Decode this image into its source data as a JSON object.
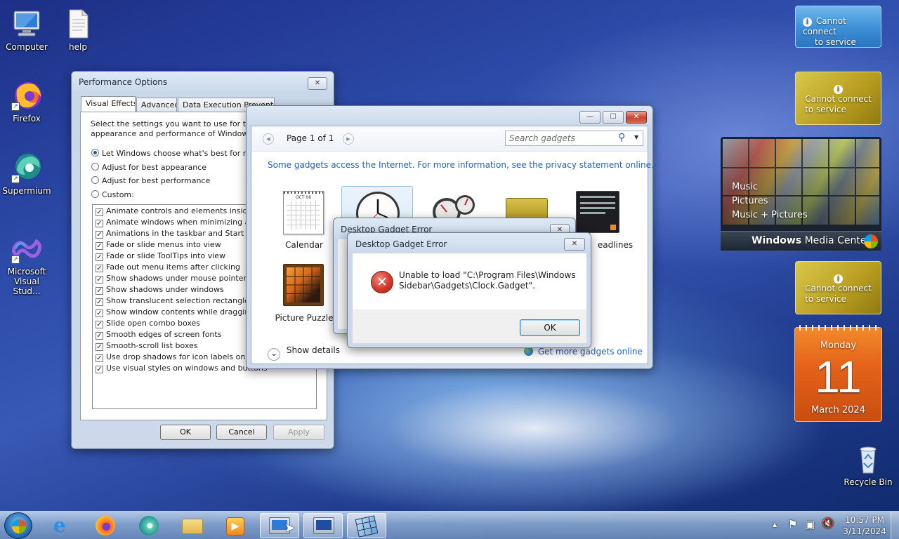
{
  "desktop": {
    "icons": [
      {
        "label": "Computer"
      },
      {
        "label": "help"
      },
      {
        "label": "Firefox"
      },
      {
        "label": "Supermium"
      },
      {
        "label": "Microsoft Visual Stud..."
      },
      {
        "label": "Recycle Bin"
      }
    ]
  },
  "perf": {
    "title": "Performance Options",
    "close_glyph": "✕",
    "tabs": [
      "Visual Effects",
      "Advanced",
      "Data Execution Prevention"
    ],
    "intro": "Select the settings you want to use for the appearance and performance of Windows on this computer.",
    "radios": [
      {
        "label": "Let Windows choose what's best for my computer",
        "selected": true
      },
      {
        "label": "Adjust for best appearance",
        "selected": false
      },
      {
        "label": "Adjust for best performance",
        "selected": false
      },
      {
        "label": "Custom:",
        "selected": false
      }
    ],
    "checks": [
      "Animate controls and elements inside windows",
      "Animate windows when minimizing and maximizing",
      "Animations in the taskbar and Start Menu",
      "Fade or slide menus into view",
      "Fade or slide ToolTips into view",
      "Fade out menu items after clicking",
      "Show shadows under mouse pointer",
      "Show shadows under windows",
      "Show translucent selection rectangle",
      "Show window contents while dragging",
      "Slide open combo boxes",
      "Smooth edges of screen fonts",
      "Smooth-scroll list boxes",
      "Use drop shadows for icon labels on the desktop",
      "Use visual styles on windows and buttons"
    ],
    "check_glyph": "✓",
    "ok": "OK",
    "cancel": "Cancel",
    "apply": "Apply"
  },
  "gallery": {
    "min_glyph": "—",
    "max_glyph": "☐",
    "close_glyph": "✕",
    "page": "Page 1 of 1",
    "prev_glyph": "◀",
    "next_glyph": "▶",
    "search_placeholder": "Search gadgets",
    "search_glyph": "⚲",
    "dropdown_glyph": "▼",
    "notice": "Some gadgets access the Internet.  For more information, see the privacy statement online.",
    "gadgets": [
      "Calendar",
      "Clock",
      "CPU Meter",
      "Currency",
      "Feed Headlines",
      "Picture Puzzle"
    ],
    "headlines_visible": "eadlines",
    "calendar_month": "OCT 06",
    "show_details": "Show details",
    "show_details_glyph": "⌄",
    "more_online": "Get more gadgets online"
  },
  "error_back": {
    "title": "Desktop Gadget Error",
    "close_glyph": "✕"
  },
  "error": {
    "title": "Desktop Gadget Error",
    "close_glyph": "✕",
    "message_line1": "Unable to load \"C:\\Program Files\\Windows",
    "message_line2": "Sidebar\\Gadgets\\Clock.Gadget\".",
    "error_glyph": "✕",
    "ok": "OK"
  },
  "sidebar": {
    "service_line1": "Cannot connect",
    "service_line2": "to service",
    "info_glyph": "i",
    "media_center": {
      "items": [
        "Music",
        "Pictures",
        "Music + Pictures"
      ],
      "brand_bold": "Windows",
      "brand_rest": " Media Center"
    },
    "calendar": {
      "weekday": "Monday",
      "day": "11",
      "month_year": "March 2024"
    }
  },
  "taskbar": {
    "clock_time": "10:57 PM",
    "clock_date": "3/11/2024",
    "tray_arrow": "▲",
    "tray_flag": "⚑",
    "tray_net": "▣",
    "tray_vol": "🔇"
  },
  "colors": {
    "link": "#1b62c6",
    "error_red": "#d03a2c",
    "calendar_orange": "#e5631a",
    "service_tile": "#c9b12a"
  }
}
